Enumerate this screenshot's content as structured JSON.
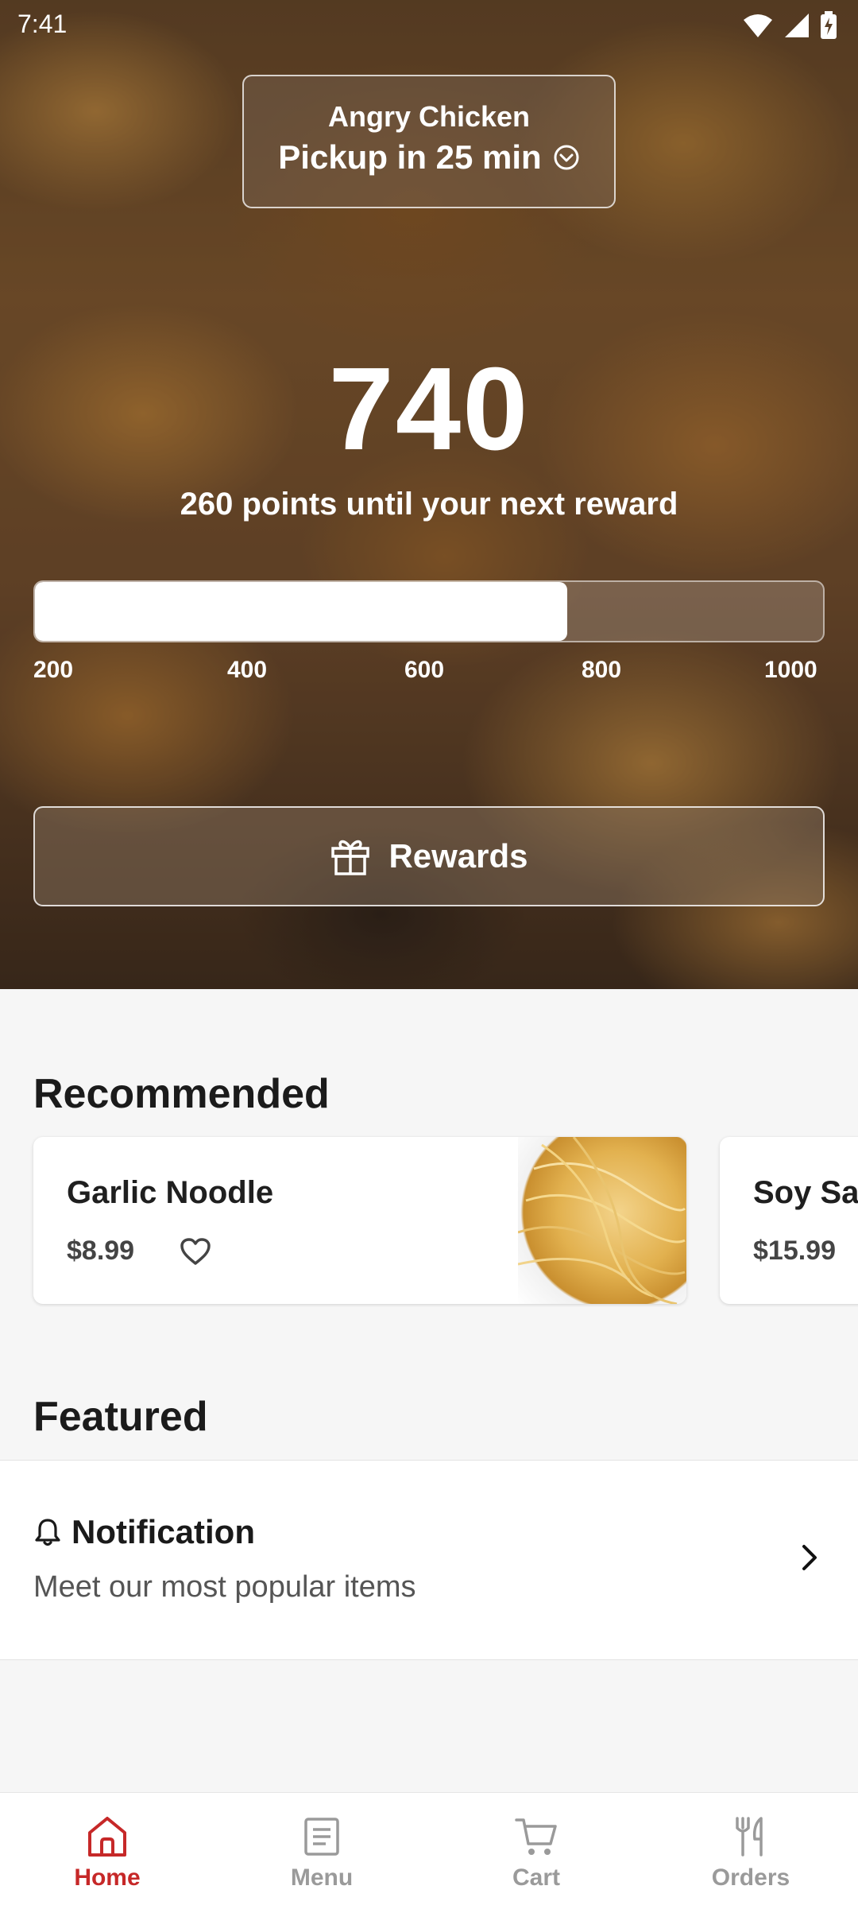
{
  "status_bar": {
    "time": "7:41"
  },
  "hero": {
    "store_name": "Angry Chicken",
    "pickup_text": "Pickup in 25 min",
    "points": "740",
    "points_subtitle": "260 points until your next reward",
    "progress": {
      "current": 740,
      "min": 200,
      "max": 1000
    },
    "ticks": [
      "200",
      "400",
      "600",
      "800",
      "1000"
    ],
    "rewards_label": "Rewards"
  },
  "recommended": {
    "title": "Recommended",
    "items": [
      {
        "name": "Garlic Noodle",
        "price": "$8.99",
        "image": "noodle-image"
      },
      {
        "name": "Soy Sa",
        "price": "$15.99"
      }
    ]
  },
  "featured": {
    "title": "Featured",
    "notification_title": "Notification",
    "notification_subtitle": "Meet our most popular items"
  },
  "bottom_nav": {
    "items": [
      {
        "label": "Home",
        "icon": "home-icon",
        "active": true
      },
      {
        "label": "Menu",
        "icon": "menu-icon",
        "active": false
      },
      {
        "label": "Cart",
        "icon": "cart-icon",
        "active": false
      },
      {
        "label": "Orders",
        "icon": "orders-icon",
        "active": false
      }
    ]
  },
  "colors": {
    "accent": "#c62828",
    "inactive": "#9a9a9a",
    "background": "#f6f6f6"
  }
}
